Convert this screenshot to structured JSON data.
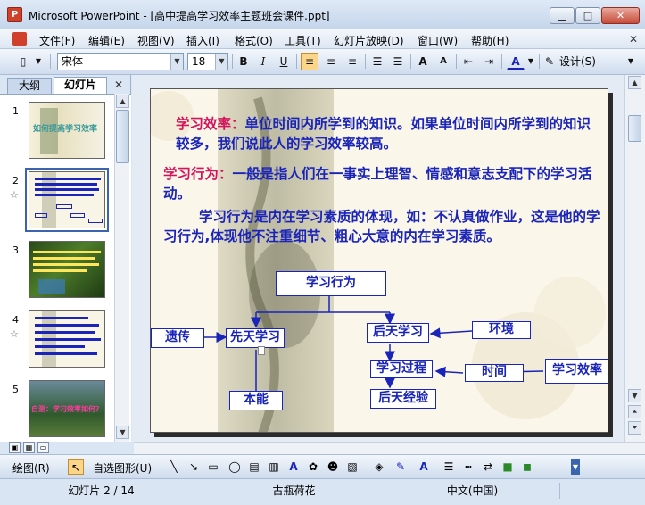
{
  "window": {
    "title": "Microsoft PowerPoint - [高中提高学习效率主题班会课件.ppt]",
    "app_badge": "P"
  },
  "menu": [
    "文件(F)",
    "编辑(E)",
    "视图(V)",
    "插入(I)",
    "格式(O)",
    "工具(T)",
    "幻灯片放映(D)",
    "窗口(W)",
    "帮助(H)"
  ],
  "toolbar": {
    "font_name": "宋体",
    "font_size": "18",
    "design_label": "设计(S)"
  },
  "tabs": {
    "outline": "大纲",
    "slides": "幻灯片"
  },
  "thumbnails": [
    {
      "num": "1",
      "caption": "如何提高学习效率"
    },
    {
      "num": "2",
      "star": "☆"
    },
    {
      "num": "3"
    },
    {
      "num": "4",
      "star": "☆"
    },
    {
      "num": "5",
      "caption": "自测：学习效率如何？"
    }
  ],
  "slide": {
    "p1_term": "学习效率：",
    "p1_text": "单位时间内所学到的知识。如果单位时间内所学到的知识较多，我们说此人的学习效率较高。",
    "p2_term": "学习行为：",
    "p2_text": "一般是指人们在一事实上理智、情感和意志支配下的学习活动。",
    "p3_text": "学习行为是内在学习素质的体现，如：不认真做作业，这是他的学习行为,体现他不注重细节、粗心大意的内在学习素质。",
    "diagram": {
      "behavior": "学习行为",
      "heredity": "遗传",
      "innate": "先天学习",
      "acquired": "后天学习",
      "environment": "环境",
      "process": "学习过程",
      "time": "时间",
      "efficiency": "学习效率",
      "instinct": "本能",
      "experience": "后天经验"
    }
  },
  "drawbar": {
    "draw": "绘图(R)",
    "autoshape": "自选图形(U)"
  },
  "status": {
    "slide_pos": "幻灯片 2 / 14",
    "template": "古瓶荷花",
    "language": "中文(中国)"
  },
  "colors": {
    "slide_text": "#1a24b8",
    "highlight": "#d4145a"
  }
}
